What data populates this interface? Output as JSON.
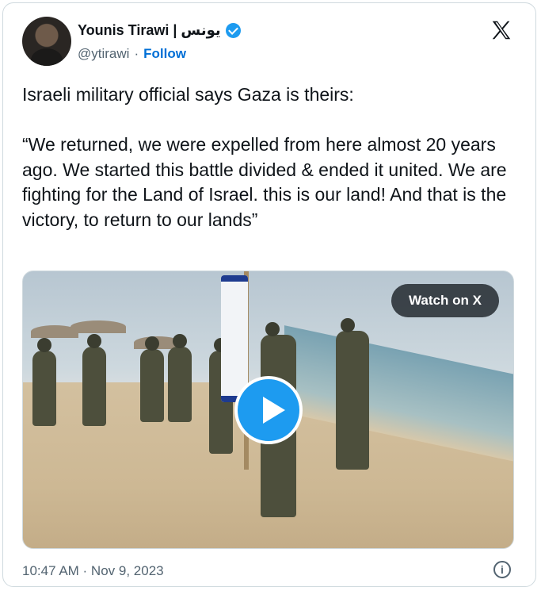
{
  "author": {
    "name": "Younis Tirawi | يونس",
    "handle": "@ytirawi",
    "separator": "·",
    "follow_label": "Follow",
    "avatar_icon": "avatar-photo",
    "verified_icon": "verified-badge-icon"
  },
  "platform_logo": "x-logo-icon",
  "tweet": {
    "text": "Israeli military official says Gaza is theirs:\n\n“We returned, we were expelled from here almost 20 years ago. We started this battle divided & ended it united. We are fighting for the Land of Israel. this is our land! And that is the victory, to return to our lands”"
  },
  "media": {
    "watch_label": "Watch on X",
    "play_icon": "play-icon"
  },
  "footer": {
    "timestamp": "10:47 AM · Nov 9, 2023",
    "info_icon": "info-icon",
    "info_glyph": "i"
  },
  "colors": {
    "accent": "#1d9bf0",
    "link": "#006fd6",
    "secondary_text": "#536471",
    "border": "#cfd9de"
  }
}
